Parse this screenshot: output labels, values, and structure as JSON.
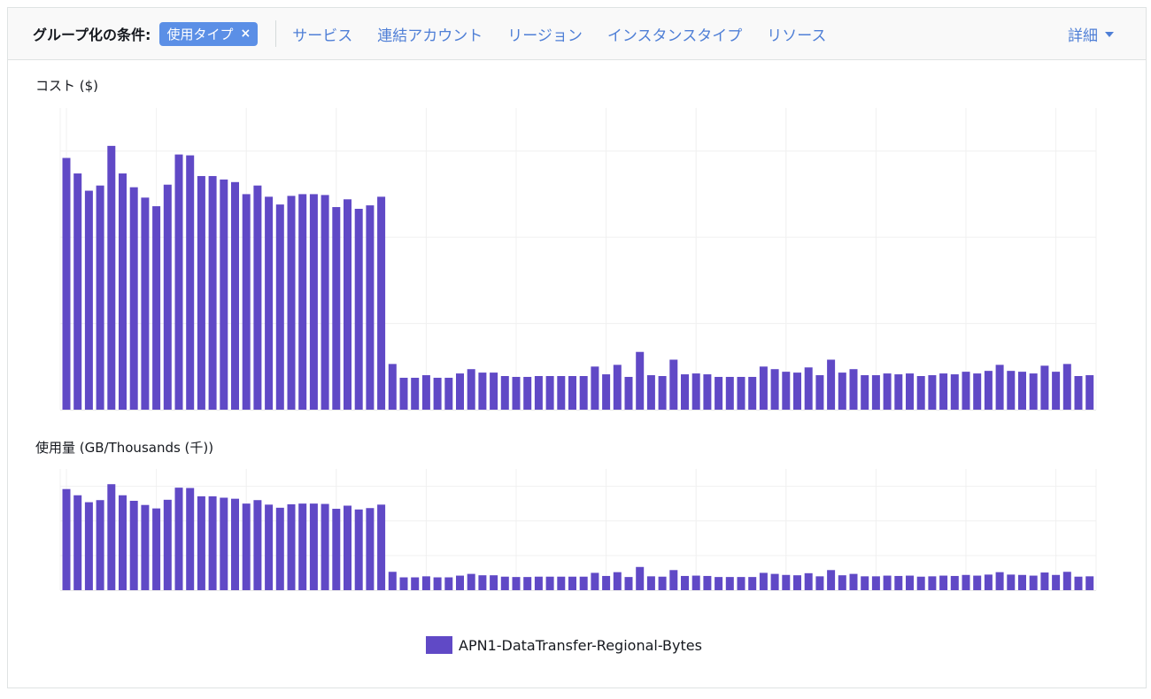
{
  "header": {
    "group_by_label": "グループ化の条件:",
    "selected_chip": "使用タイプ",
    "chip_remove": "×",
    "options": [
      "サービス",
      "連結アカウント",
      "リージョン",
      "インスタンスタイプ",
      "リソース"
    ],
    "more_label": "詳細"
  },
  "colors": {
    "bar": "#6049c6",
    "link": "#4f7fd6",
    "chip": "#5b8fe6"
  },
  "chart_data": [
    {
      "type": "bar",
      "title": "コスト ($)",
      "xlabel": "",
      "ylabel": "",
      "ylim": [
        0,
        3.5
      ],
      "grid": true,
      "series": [
        {
          "name": "APN1-DataTransfer-Regional-Bytes",
          "values": [
            2.92,
            2.74,
            2.54,
            2.6,
            3.06,
            2.74,
            2.58,
            2.46,
            2.36,
            2.61,
            2.96,
            2.95,
            2.71,
            2.71,
            2.67,
            2.64,
            2.5,
            2.6,
            2.47,
            2.38,
            2.48,
            2.5,
            2.5,
            2.49,
            2.35,
            2.44,
            2.33,
            2.37,
            2.47,
            0.53,
            0.37,
            0.37,
            0.4,
            0.37,
            0.37,
            0.42,
            0.47,
            0.43,
            0.43,
            0.39,
            0.38,
            0.38,
            0.39,
            0.39,
            0.39,
            0.39,
            0.39,
            0.5,
            0.41,
            0.52,
            0.38,
            0.67,
            0.4,
            0.39,
            0.58,
            0.41,
            0.42,
            0.41,
            0.38,
            0.38,
            0.38,
            0.38,
            0.5,
            0.47,
            0.44,
            0.43,
            0.49,
            0.4,
            0.58,
            0.43,
            0.47,
            0.4,
            0.4,
            0.42,
            0.41,
            0.42,
            0.39,
            0.4,
            0.42,
            0.41,
            0.44,
            0.42,
            0.45,
            0.52,
            0.45,
            0.44,
            0.42,
            0.51,
            0.44,
            0.53,
            0.39,
            0.4
          ]
        }
      ]
    },
    {
      "type": "bar",
      "title": "使用量 (GB/Thousands (千))",
      "xlabel": "",
      "ylabel": "",
      "ylim": [
        0,
        3.5
      ],
      "grid": true,
      "series": [
        {
          "name": "APN1-DataTransfer-Regional-Bytes",
          "values": [
            2.92,
            2.74,
            2.54,
            2.6,
            3.06,
            2.74,
            2.58,
            2.46,
            2.36,
            2.61,
            2.96,
            2.95,
            2.71,
            2.71,
            2.67,
            2.64,
            2.5,
            2.6,
            2.47,
            2.38,
            2.48,
            2.5,
            2.5,
            2.49,
            2.35,
            2.44,
            2.33,
            2.37,
            2.47,
            0.53,
            0.37,
            0.37,
            0.4,
            0.37,
            0.37,
            0.42,
            0.47,
            0.43,
            0.43,
            0.39,
            0.38,
            0.38,
            0.39,
            0.39,
            0.39,
            0.39,
            0.39,
            0.5,
            0.41,
            0.52,
            0.38,
            0.67,
            0.4,
            0.39,
            0.58,
            0.41,
            0.42,
            0.41,
            0.38,
            0.38,
            0.38,
            0.38,
            0.5,
            0.47,
            0.44,
            0.43,
            0.49,
            0.4,
            0.58,
            0.43,
            0.47,
            0.4,
            0.4,
            0.42,
            0.41,
            0.42,
            0.39,
            0.4,
            0.42,
            0.41,
            0.44,
            0.42,
            0.45,
            0.52,
            0.45,
            0.44,
            0.42,
            0.51,
            0.44,
            0.53,
            0.39,
            0.4
          ]
        }
      ]
    }
  ],
  "legend": {
    "label": "APN1-DataTransfer-Regional-Bytes"
  }
}
